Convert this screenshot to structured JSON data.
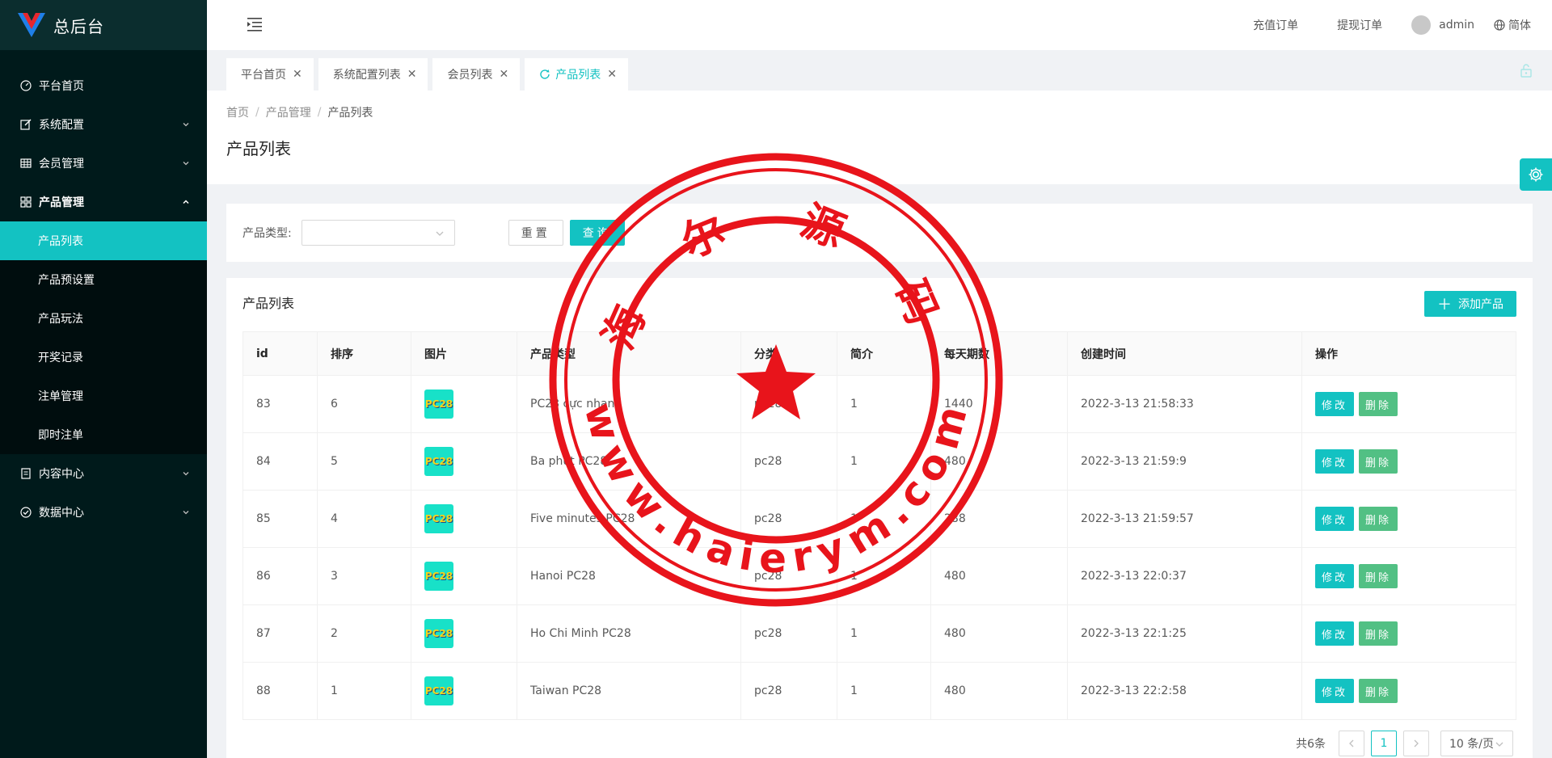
{
  "app": {
    "title": "总后台",
    "brand_color": "#13c2c2"
  },
  "sidebar": {
    "items": [
      {
        "label": "平台首页",
        "icon": "dashboard-icon",
        "has_children": false
      },
      {
        "label": "系统配置",
        "icon": "edit-icon",
        "has_children": true
      },
      {
        "label": "会员管理",
        "icon": "table-icon",
        "has_children": true
      },
      {
        "label": "产品管理",
        "icon": "appstore-icon",
        "has_children": true,
        "expanded": true,
        "children": [
          {
            "label": "产品列表",
            "active": true
          },
          {
            "label": "产品预设置"
          },
          {
            "label": "产品玩法"
          },
          {
            "label": "开奖记录"
          },
          {
            "label": "注单管理"
          },
          {
            "label": "即时注单"
          }
        ]
      },
      {
        "label": "内容中心",
        "icon": "profile-icon",
        "has_children": true
      },
      {
        "label": "数据中心",
        "icon": "check-circle-icon",
        "has_children": true
      }
    ]
  },
  "header": {
    "links": [
      "充值订单",
      "提现订单"
    ],
    "user": "admin",
    "lang": "简体"
  },
  "tabs": [
    {
      "label": "平台首页"
    },
    {
      "label": "系统配置列表"
    },
    {
      "label": "会员列表"
    },
    {
      "label": "产品列表",
      "active": true
    }
  ],
  "breadcrumb": [
    "首页",
    "产品管理",
    "产品列表"
  ],
  "page_title": "产品列表",
  "search": {
    "label": "产品类型:",
    "select_value": "",
    "reset_label": "重置",
    "query_label": "查询"
  },
  "table": {
    "title": "产品列表",
    "add_label": "添加产品",
    "columns": [
      "id",
      "排序",
      "图片",
      "产品类型",
      "分类",
      "简介",
      "每天期数",
      "创建时间",
      "操作"
    ],
    "image_text": "PC28",
    "rows": [
      {
        "id": "83",
        "sort": "6",
        "type": "PC28 cực nhanh",
        "category": "pc28",
        "intro": "1",
        "daily": "1440",
        "created": "2022-3-13 21:58:33"
      },
      {
        "id": "84",
        "sort": "5",
        "type": "Ba phút PC28",
        "category": "pc28",
        "intro": "1",
        "daily": "480",
        "created": "2022-3-13 21:59:9"
      },
      {
        "id": "85",
        "sort": "4",
        "type": "Five minutes PC28",
        "category": "pc28",
        "intro": "1",
        "daily": "288",
        "created": "2022-3-13 21:59:57"
      },
      {
        "id": "86",
        "sort": "3",
        "type": "Hanoi PC28",
        "category": "pc28",
        "intro": "1",
        "daily": "480",
        "created": "2022-3-13 22:0:37"
      },
      {
        "id": "87",
        "sort": "2",
        "type": "Ho Chi Minh PC28",
        "category": "pc28",
        "intro": "1",
        "daily": "480",
        "created": "2022-3-13 22:1:25"
      },
      {
        "id": "88",
        "sort": "1",
        "type": "Taiwan PC28",
        "category": "pc28",
        "intro": "1",
        "daily": "480",
        "created": "2022-3-13 22:2:58"
      }
    ],
    "edit_label": "修改",
    "delete_label": "删除"
  },
  "pagination": {
    "total_text": "共6条",
    "current_page": "1",
    "page_size": "10 条/页"
  },
  "watermark": {
    "top_text": "海 尔 源 码",
    "bottom_text": "www.haierym.com",
    "color": "#e8141b"
  }
}
